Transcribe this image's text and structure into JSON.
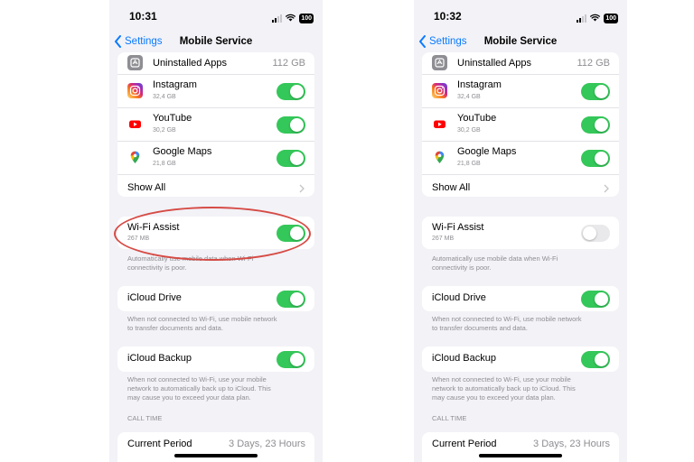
{
  "screens": [
    {
      "time": "10:31",
      "battery": "100",
      "back_label": "Settings",
      "title": "Mobile Service",
      "apps": [
        {
          "name": "Uninstalled Apps",
          "value": "112 GB"
        },
        {
          "name": "Instagram",
          "size": "32,4 GB",
          "enabled": true
        },
        {
          "name": "YouTube",
          "size": "30,2 GB",
          "enabled": true
        },
        {
          "name": "Google Maps",
          "size": "21,8 GB",
          "enabled": true
        }
      ],
      "show_all": "Show All",
      "wifi_assist": {
        "label": "Wi-Fi Assist",
        "size": "267 MB",
        "enabled": true,
        "note_line1": "Automatically use mobile data when Wi-Fi",
        "note_line2": "connectivity is poor."
      },
      "icloud_drive": {
        "label": "iCloud Drive",
        "enabled": true,
        "note_line1": "When not connected to Wi-Fi, use mobile network",
        "note_line2": "to transfer documents and data."
      },
      "icloud_backup": {
        "label": "iCloud Backup",
        "enabled": true,
        "note_line1": "When not connected to Wi-Fi, use your mobile",
        "note_line2": "network to automatically back up to iCloud. This",
        "note_line3": "may cause you to exceed your data plan."
      },
      "call_time_header": "CALL TIME",
      "current_period": {
        "label": "Current Period",
        "value": "3 Days, 23 Hours"
      }
    },
    {
      "time": "10:32",
      "battery": "100",
      "back_label": "Settings",
      "title": "Mobile Service",
      "apps": [
        {
          "name": "Uninstalled Apps",
          "value": "112 GB"
        },
        {
          "name": "Instagram",
          "size": "32,4 GB",
          "enabled": true
        },
        {
          "name": "YouTube",
          "size": "30,2 GB",
          "enabled": true
        },
        {
          "name": "Google Maps",
          "size": "21,8 GB",
          "enabled": true
        }
      ],
      "show_all": "Show All",
      "wifi_assist": {
        "label": "Wi-Fi Assist",
        "size": "267 MB",
        "enabled": false,
        "note_line1": "Automatically use mobile data when Wi-Fi",
        "note_line2": "connectivity is poor."
      },
      "icloud_drive": {
        "label": "iCloud Drive",
        "enabled": true,
        "note_line1": "When not connected to Wi-Fi, use mobile network",
        "note_line2": "to transfer documents and data."
      },
      "icloud_backup": {
        "label": "iCloud Backup",
        "enabled": true,
        "note_line1": "When not connected to Wi-Fi, use your mobile",
        "note_line2": "network to automatically back up to iCloud. This",
        "note_line3": "may cause you to exceed your data plan."
      },
      "call_time_header": "CALL TIME",
      "current_period": {
        "label": "Current Period",
        "value": "3 Days, 23 Hours"
      }
    }
  ],
  "colors": {
    "accent": "#0a7aff",
    "toggle_on": "#34c759",
    "toggle_off": "#e9e9eb",
    "annotation": "#d64b45"
  },
  "icons": {
    "uninstalled": "app-store-icon",
    "instagram": "instagram-icon",
    "youtube": "youtube-icon",
    "maps": "google-maps-icon"
  },
  "annotation": {
    "shape": "ellipse",
    "target": "screens.0.wifi_assist"
  }
}
